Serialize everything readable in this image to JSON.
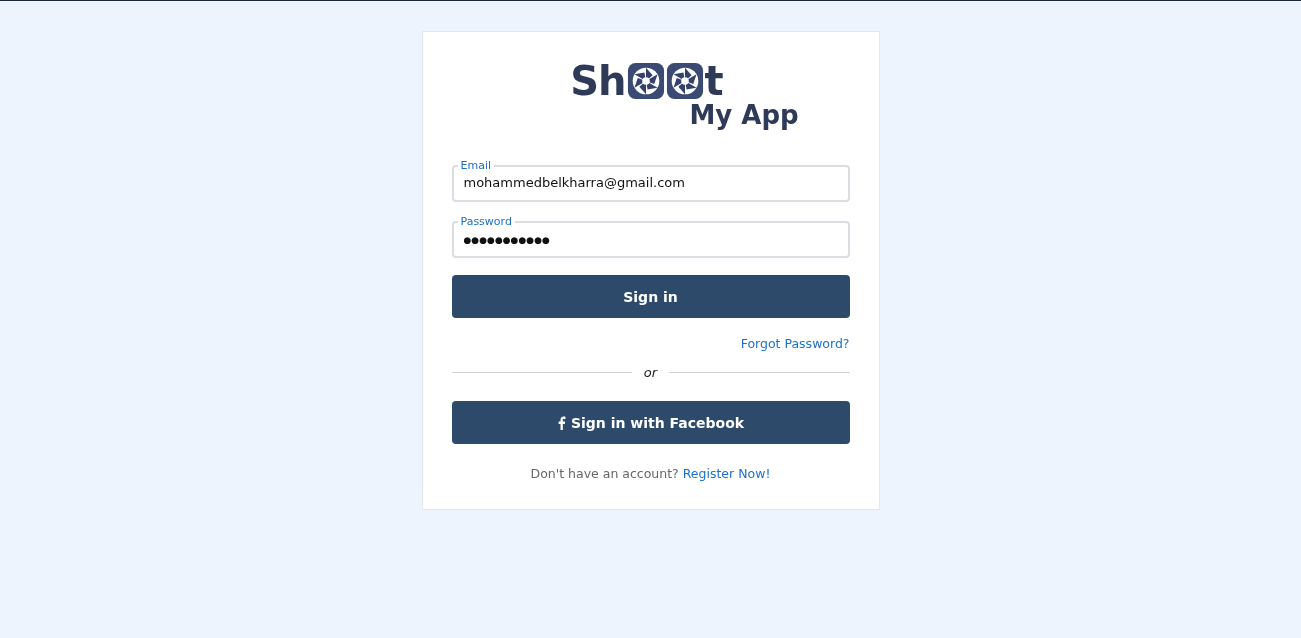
{
  "logo": {
    "text_before": "Sh",
    "text_after": "t",
    "tagline": "My App"
  },
  "fields": [
    {
      "label": "Email",
      "value": "mohammedbelkharra@gmail.com",
      "kind": "email"
    },
    {
      "label": "Password",
      "value": "●●●●●●●●●●●",
      "kind": "password"
    }
  ],
  "sign_in_button": "Sign in",
  "forgot_link": "Forgot Password?",
  "divider": "or",
  "facebook_button": "Sign in with Facebook",
  "register": {
    "prompt": "Don't have an account?",
    "link": "Register Now!"
  }
}
